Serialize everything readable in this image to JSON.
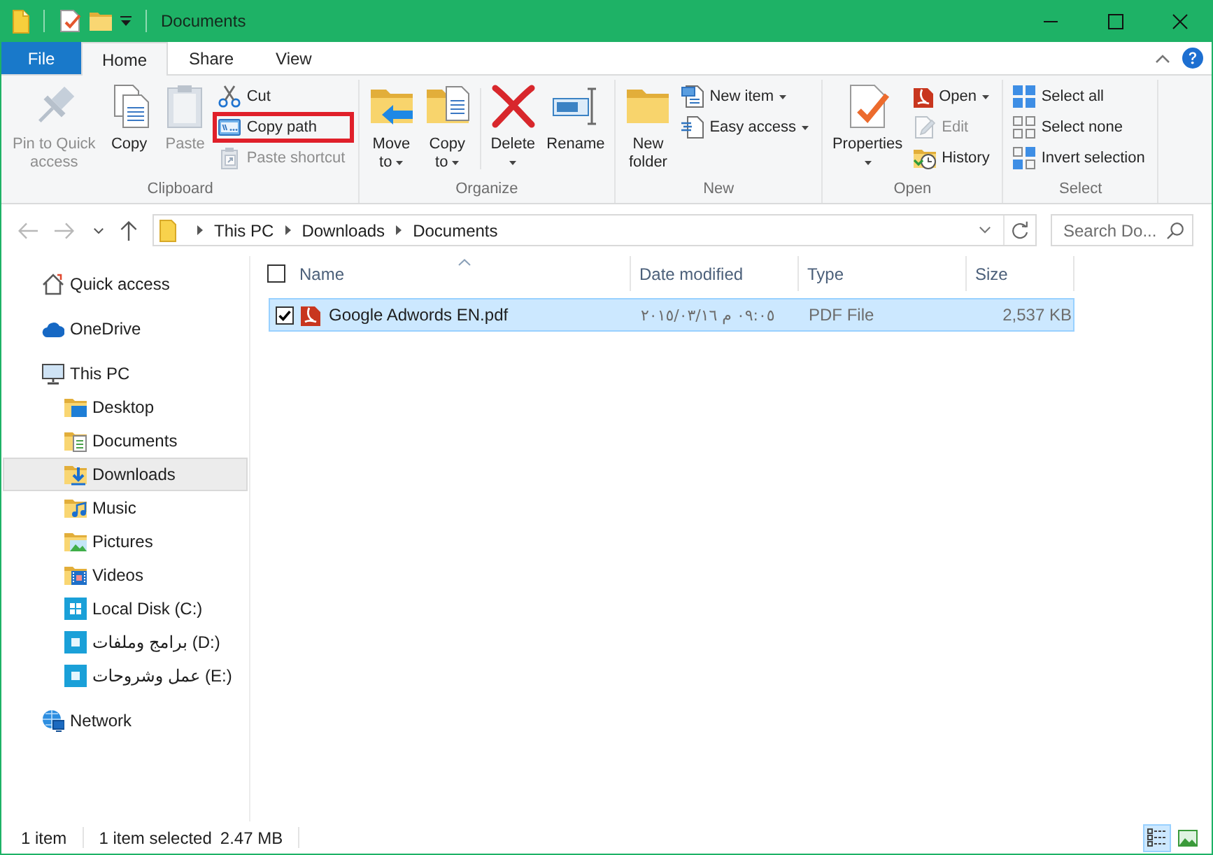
{
  "window": {
    "title": "Documents"
  },
  "ribbon_tabs": [
    {
      "label": "File",
      "kind": "file",
      "selected": false
    },
    {
      "label": "Home",
      "kind": "tab",
      "selected": true
    },
    {
      "label": "Share",
      "kind": "tab",
      "selected": false
    },
    {
      "label": "View",
      "kind": "tab",
      "selected": false
    }
  ],
  "ribbon_groups": [
    {
      "label": "Clipboard",
      "items": [
        {
          "kind": "large",
          "label": "Pin to Quick\naccess",
          "disabled": true,
          "dropdown": false,
          "highlighted": false
        },
        {
          "kind": "large",
          "label": "Copy",
          "disabled": false,
          "dropdown": false,
          "highlighted": false
        },
        {
          "kind": "large",
          "label": "Paste",
          "disabled": true,
          "dropdown": false,
          "highlighted": false
        },
        {
          "kind": "small",
          "label": "Cut",
          "disabled": false,
          "dropdown": false,
          "highlighted": false
        },
        {
          "kind": "small",
          "label": "Copy path",
          "disabled": false,
          "dropdown": false,
          "highlighted": true
        },
        {
          "kind": "small",
          "label": "Paste shortcut",
          "disabled": true,
          "dropdown": false,
          "highlighted": false
        }
      ]
    },
    {
      "label": "Organize",
      "items": [
        {
          "kind": "large",
          "label": "Move\nto",
          "disabled": false,
          "dropdown": true,
          "highlighted": false
        },
        {
          "kind": "large",
          "label": "Copy\nto",
          "disabled": false,
          "dropdown": true,
          "highlighted": false
        },
        {
          "kind": "separator"
        },
        {
          "kind": "large",
          "label": "Delete",
          "disabled": false,
          "dropdown": true,
          "highlighted": false
        },
        {
          "kind": "large",
          "label": "Rename",
          "disabled": false,
          "dropdown": false,
          "highlighted": false
        }
      ]
    },
    {
      "label": "New",
      "items": [
        {
          "kind": "large",
          "label": "New\nfolder",
          "disabled": false,
          "dropdown": false,
          "highlighted": false
        },
        {
          "kind": "small",
          "label": "New item",
          "disabled": false,
          "dropdown": true,
          "highlighted": false
        },
        {
          "kind": "small",
          "label": "Easy access",
          "disabled": false,
          "dropdown": true,
          "highlighted": false
        }
      ]
    },
    {
      "label": "Open",
      "items": [
        {
          "kind": "large",
          "label": "Properties",
          "disabled": false,
          "dropdown": true,
          "highlighted": false
        },
        {
          "kind": "small",
          "label": "Open",
          "disabled": false,
          "dropdown": true,
          "highlighted": false
        },
        {
          "kind": "small",
          "label": "Edit",
          "disabled": true,
          "dropdown": false,
          "highlighted": false
        },
        {
          "kind": "small",
          "label": "History",
          "disabled": false,
          "dropdown": false,
          "highlighted": false
        }
      ]
    },
    {
      "label": "Select",
      "items": [
        {
          "kind": "small",
          "label": "Select all",
          "disabled": false,
          "dropdown": false,
          "highlighted": false
        },
        {
          "kind": "small",
          "label": "Select none",
          "disabled": false,
          "dropdown": false,
          "highlighted": false
        },
        {
          "kind": "small",
          "label": "Invert selection",
          "disabled": false,
          "dropdown": false,
          "highlighted": false
        }
      ]
    }
  ],
  "address_bar": {
    "nav_buttons": [
      {
        "kind": "back",
        "disabled": true
      },
      {
        "kind": "forward",
        "disabled": true
      },
      {
        "kind": "recent",
        "disabled": false
      },
      {
        "kind": "up",
        "disabled": false
      }
    ],
    "path": [
      "This PC",
      "Downloads",
      "Documents"
    ]
  },
  "search": {
    "placeholder": "Search Do..."
  },
  "navigation_pane": {
    "items": [
      {
        "label": "Quick access",
        "selected": false
      },
      {
        "label": "OneDrive",
        "selected": false
      },
      {
        "label": "This PC",
        "selected": false,
        "children": [
          {
            "label": "Desktop",
            "selected": false
          },
          {
            "label": "Documents",
            "selected": false
          },
          {
            "label": "Downloads",
            "selected": true
          },
          {
            "label": "Music",
            "selected": false
          },
          {
            "label": "Pictures",
            "selected": false
          },
          {
            "label": "Videos",
            "selected": false
          },
          {
            "label": "Local Disk (C:)",
            "selected": false
          },
          {
            "label": "برامج وملفات (D:)",
            "selected": false
          },
          {
            "label": "عمل وشروحات (E:)",
            "selected": false
          }
        ]
      },
      {
        "label": "Network",
        "selected": false
      }
    ]
  },
  "file_list": {
    "header_checkbox": {
      "checked": false
    },
    "columns": [
      {
        "label": "Name",
        "sorted": true
      },
      {
        "label": "Date modified",
        "sorted": false
      },
      {
        "label": "Type",
        "sorted": false
      },
      {
        "label": "Size",
        "sorted": false
      }
    ],
    "rows": [
      {
        "name": "Google Adwords EN.pdf",
        "date_modified": "٢٠١٥/٠٣/١٦ م ٠٩:٠٥",
        "type": "PDF File",
        "size": "2,537 KB",
        "selected": true,
        "checked": true
      }
    ]
  },
  "status_bar": {
    "item_count": "1 item",
    "selection": "1 item selected",
    "selection_size": "2.47 MB",
    "views": [
      {
        "kind": "details",
        "selected": true
      },
      {
        "kind": "large_icons",
        "selected": false
      }
    ]
  }
}
